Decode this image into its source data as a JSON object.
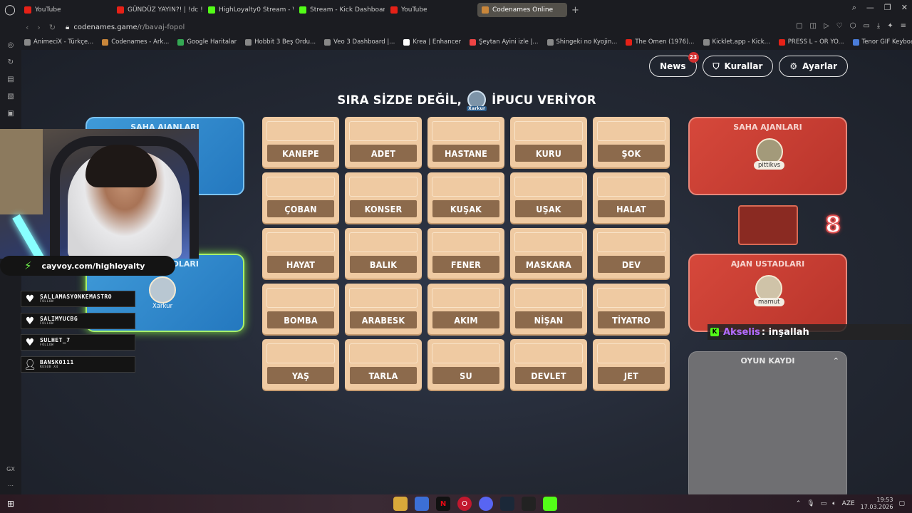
{
  "tabs": [
    {
      "label": "YouTube",
      "icon": "youtube"
    },
    {
      "label": "GÜNDÜZ YAYIN?! | !dc !in",
      "icon": "youtube"
    },
    {
      "label": "HighLoyalty0 Stream - Wa",
      "icon": "kick"
    },
    {
      "label": "Stream - Kick Dashboard",
      "icon": "kick"
    },
    {
      "label": "YouTube",
      "icon": "youtube"
    },
    {
      "label": "Codenames Online",
      "icon": "codenames",
      "active": true
    }
  ],
  "address": {
    "host": "codenames.game",
    "path": "/r/bavaj-fopol"
  },
  "bookmarks": [
    "AnimeciX - Türkçe...",
    "Codenames - Ark...",
    "Google Haritalar",
    "Hobbit 3 Beş Ordu...",
    "Veo 3 Dashboard |...",
    "Krea | Enhancer",
    "Şeytan Ayini izle |...",
    "Shingeki no Kyojin...",
    "The Omen (1976)...",
    "Kicklet.app - Kick...",
    "PRESS L – OR YO...",
    "Tenor GIF Keyboa..."
  ],
  "header": {
    "news_label": "News",
    "news_count": "23",
    "rules_label": "Kurallar",
    "settings_label": "Ayarlar"
  },
  "turn": {
    "prefix": "SIRA SİZDE DEĞİL,",
    "avatar_name": "Xarkur",
    "suffix": "İPUCU VERİYOR"
  },
  "board": [
    "KANEPE",
    "ADET",
    "HASTANE",
    "KURU",
    "ŞOK",
    "ÇOBAN",
    "KONSER",
    "KUŞAK",
    "UŞAK",
    "HALAT",
    "HAYAT",
    "BALIK",
    "FENER",
    "MASKARA",
    "DEV",
    "BOMBA",
    "ARABESK",
    "AKIM",
    "NİŞAN",
    "TİYATRO",
    "YAŞ",
    "TARLA",
    "SU",
    "DEVLET",
    "JET"
  ],
  "red_team": {
    "operatives_title": "SAHA AJANLARI",
    "operative": "pittikvs",
    "score": "8",
    "spymasters_title": "AJAN USTADLARI",
    "spymaster": "mamut"
  },
  "blue_team": {
    "operatives_title": "SAHA AJANLARI",
    "spymasters_title_partial": "ADLARI",
    "spymaster": "Xarkur"
  },
  "game_log": {
    "title": "OYUN KAYDI"
  },
  "chat": {
    "user": "Akselis",
    "message": ": inşallah"
  },
  "overlay": {
    "cayvoy": "cayvoy.com/highloyalty",
    "alerts": [
      {
        "name": "SALLAMASYONKEMASTRO",
        "sub": "FOLLOW",
        "icon": "heart"
      },
      {
        "name": "SALIMYUCBG",
        "sub": "FOLLOW",
        "icon": "heart"
      },
      {
        "name": "SULHET_7",
        "sub": "FOLLOW",
        "icon": "heart"
      },
      {
        "name": "BANSKO111",
        "sub": "RESUB X4",
        "icon": "user"
      }
    ]
  },
  "sidebar_bottom": "GX",
  "taskbar": {
    "lang": "AZE",
    "time": "19:53",
    "date": "17.03.2026"
  },
  "colors": {
    "red": "#c93d31",
    "blue": "#2f86cc",
    "card": "#efcaa2",
    "card_label": "#8c6a4c"
  }
}
